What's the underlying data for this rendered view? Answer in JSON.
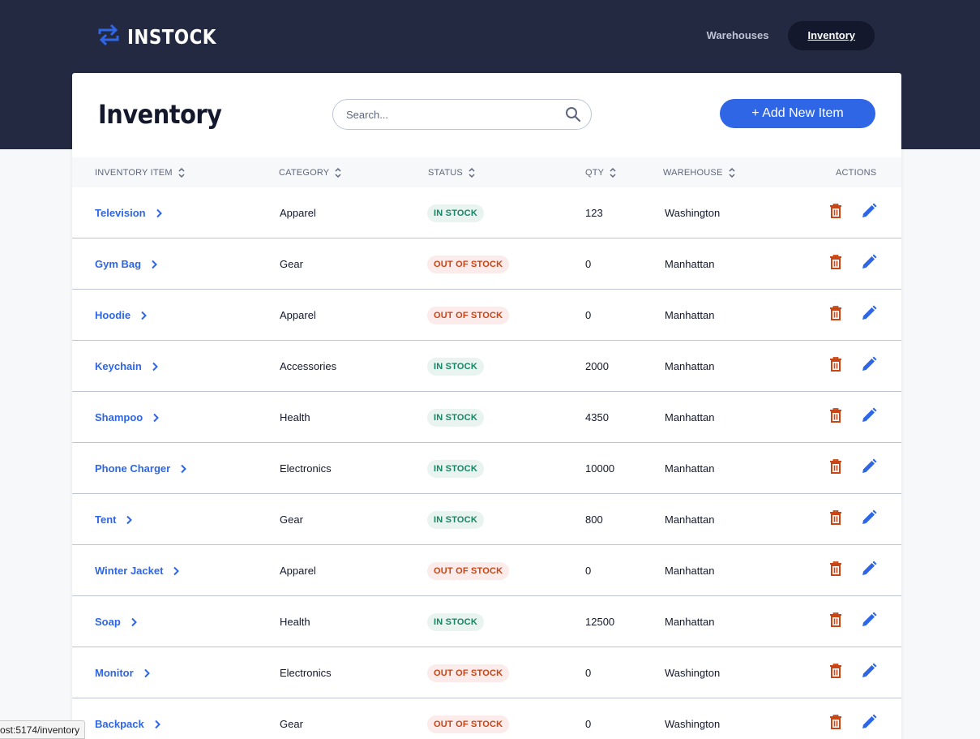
{
  "app": {
    "brand": "INSTOCK"
  },
  "nav": {
    "items": [
      {
        "label": "Warehouses",
        "active": false
      },
      {
        "label": "Inventory",
        "active": true
      }
    ]
  },
  "page": {
    "title": "Inventory",
    "search_placeholder": "Search...",
    "add_button": "+ Add New Item"
  },
  "table": {
    "headers": {
      "item": "INVENTORY ITEM",
      "category": "CATEGORY",
      "status": "STATUS",
      "qty": "QTY",
      "warehouse": "WAREHOUSE",
      "actions": "ACTIONS"
    },
    "rows": [
      {
        "item": "Television",
        "category": "Apparel",
        "status": "IN STOCK",
        "in_stock": true,
        "qty": "123",
        "warehouse": "Washington"
      },
      {
        "item": "Gym Bag",
        "category": "Gear",
        "status": "OUT OF STOCK",
        "in_stock": false,
        "qty": "0",
        "warehouse": "Manhattan"
      },
      {
        "item": "Hoodie",
        "category": "Apparel",
        "status": "OUT OF STOCK",
        "in_stock": false,
        "qty": "0",
        "warehouse": "Manhattan"
      },
      {
        "item": "Keychain",
        "category": "Accessories",
        "status": "IN STOCK",
        "in_stock": true,
        "qty": "2000",
        "warehouse": "Manhattan"
      },
      {
        "item": "Shampoo",
        "category": "Health",
        "status": "IN STOCK",
        "in_stock": true,
        "qty": "4350",
        "warehouse": "Manhattan"
      },
      {
        "item": "Phone Charger",
        "category": "Electronics",
        "status": "IN STOCK",
        "in_stock": true,
        "qty": "10000",
        "warehouse": "Manhattan"
      },
      {
        "item": "Tent",
        "category": "Gear",
        "status": "IN STOCK",
        "in_stock": true,
        "qty": "800",
        "warehouse": "Manhattan"
      },
      {
        "item": "Winter Jacket",
        "category": "Apparel",
        "status": "OUT OF STOCK",
        "in_stock": false,
        "qty": "0",
        "warehouse": "Manhattan"
      },
      {
        "item": "Soap",
        "category": "Health",
        "status": "IN STOCK",
        "in_stock": true,
        "qty": "12500",
        "warehouse": "Manhattan"
      },
      {
        "item": "Monitor",
        "category": "Electronics",
        "status": "OUT OF STOCK",
        "in_stock": false,
        "qty": "0",
        "warehouse": "Washington"
      },
      {
        "item": "Backpack",
        "category": "Gear",
        "status": "OUT OF STOCK",
        "in_stock": false,
        "qty": "0",
        "warehouse": "Washington"
      }
    ]
  },
  "statusbar": {
    "url": "ost:5174/inventory"
  },
  "colors": {
    "header_bg": "#232940",
    "accent": "#2E66E5",
    "in_stock": "#158463",
    "out_of_stock": "#C94515"
  },
  "icons": {
    "logo": "swap-arrows-icon",
    "search": "search-icon",
    "sort": "sort-icon",
    "chevron": "chevron-right-icon",
    "delete": "trash-icon",
    "edit": "pencil-icon"
  }
}
